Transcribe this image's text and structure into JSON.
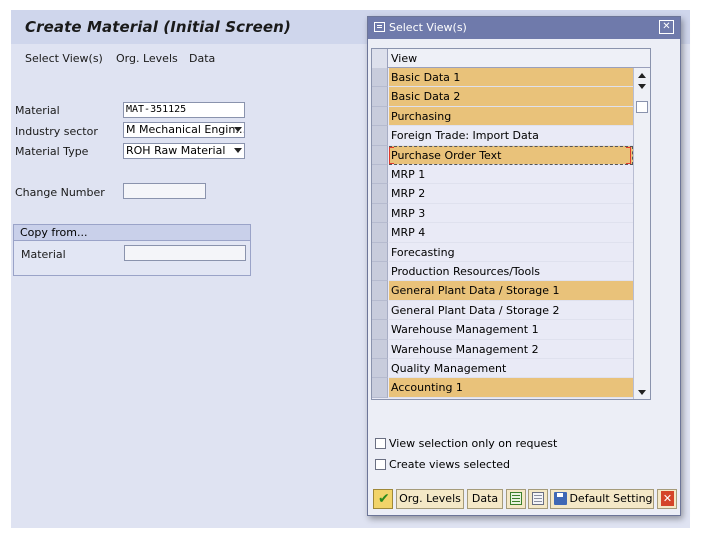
{
  "screen": {
    "title": "Create Material (Initial Screen)",
    "menu": [
      "Select View(s)",
      "Org. Levels",
      "Data"
    ]
  },
  "form": {
    "material_label": "Material",
    "material_value": "MAT-351125",
    "industry_label": "Industry sector",
    "industry_value": "M Mechanical Engin…",
    "type_label": "Material Type",
    "type_value": "ROH Raw Material",
    "change_label": "Change Number",
    "change_value": "",
    "copy_header": "Copy from...",
    "copy_material_label": "Material",
    "copy_material_value": ""
  },
  "dialog": {
    "title": "Select View(s)",
    "column_header": "View",
    "views": [
      {
        "label": "Basic Data 1",
        "selected": true
      },
      {
        "label": "Basic Data 2",
        "selected": true
      },
      {
        "label": "Purchasing",
        "selected": true
      },
      {
        "label": "Foreign Trade: Import Data",
        "selected": false
      },
      {
        "label": "Purchase Order Text",
        "selected": true,
        "focused": true
      },
      {
        "label": "MRP 1",
        "selected": false
      },
      {
        "label": "MRP 2",
        "selected": false
      },
      {
        "label": "MRP 3",
        "selected": false
      },
      {
        "label": "MRP 4",
        "selected": false
      },
      {
        "label": "Forecasting",
        "selected": false
      },
      {
        "label": "Production Resources/Tools",
        "selected": false
      },
      {
        "label": "General Plant Data / Storage 1",
        "selected": true
      },
      {
        "label": "General Plant Data / Storage 2",
        "selected": false
      },
      {
        "label": "Warehouse Management 1",
        "selected": false
      },
      {
        "label": "Warehouse Management 2",
        "selected": false
      },
      {
        "label": "Quality Management",
        "selected": false
      },
      {
        "label": "Accounting 1",
        "selected": true
      }
    ],
    "checkbox_request": {
      "label": "View selection only on request",
      "checked": false
    },
    "checkbox_create": {
      "label": "Create views selected",
      "checked": false
    },
    "buttons": {
      "org_levels": "Org. Levels",
      "data": "Data",
      "default_setting": "Default Setting"
    }
  },
  "icons": {
    "continue": "green-check-icon",
    "select_all": "select-all-icon",
    "deselect_all": "deselect-all-icon",
    "save": "save-icon",
    "cancel": "red-cancel-icon",
    "close": "close-icon"
  },
  "colors": {
    "selected_row": "#e9c27a",
    "dialog_title": "#6f7aab",
    "screen_bg": "#dfe3f2"
  }
}
